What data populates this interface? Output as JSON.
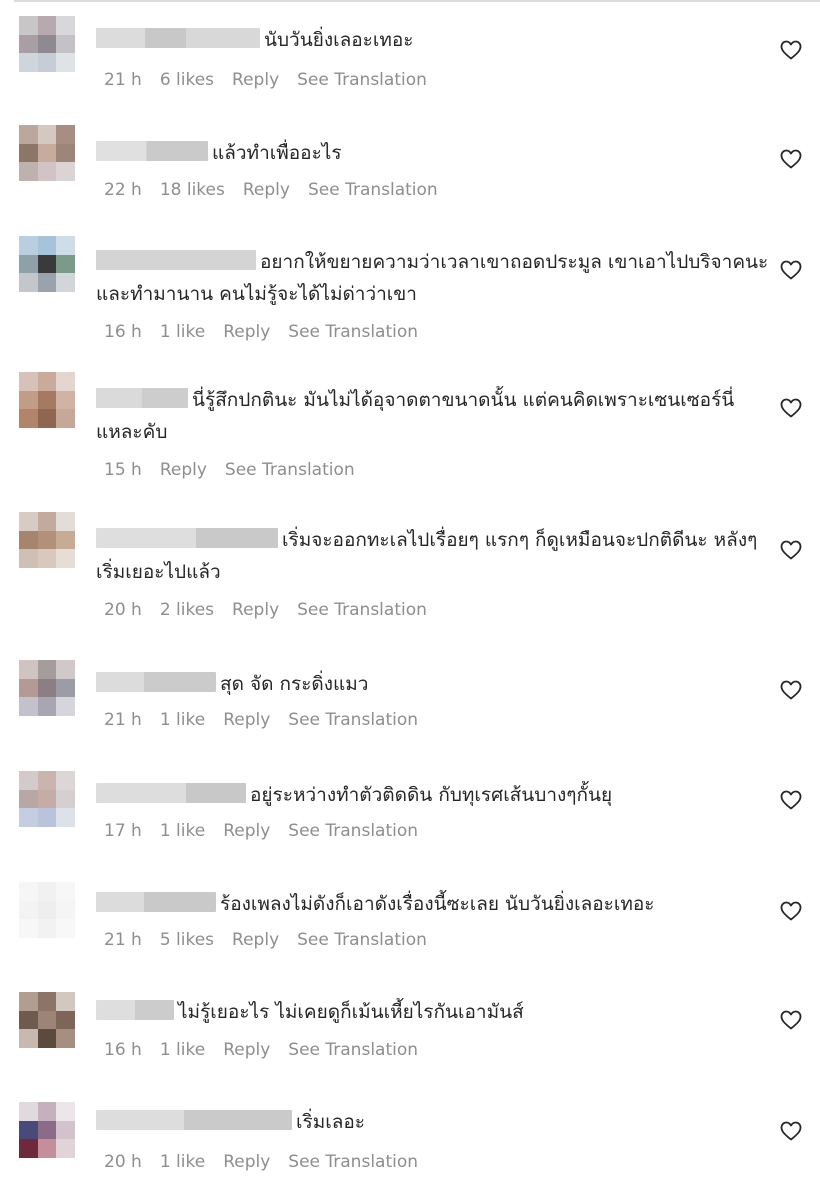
{
  "comments": [
    {
      "text": "นับวันยิ่งเลอะเทอะ",
      "time": "21 h",
      "likes": "6 likes",
      "reply": "Reply",
      "translate": "See Translation"
    },
    {
      "text": "แล้วทำเพื่ออะไร",
      "time": "22 h",
      "likes": "18 likes",
      "reply": "Reply",
      "translate": "See Translation"
    },
    {
      "text": "อยากให้ขยายความว่าเวลาเขาถอดประมูล เขาเอาไปบริจาคนะ และทำมานาน คนไม่รู้จะได้ไม่ด่าว่าเขา",
      "time": "16 h",
      "likes": "1 like",
      "reply": "Reply",
      "translate": "See Translation"
    },
    {
      "text": "นี่รู้สึกปกตินะ มันไม่ได้อุจาดตาขนาดนั้น แต่คนคิดเพราะเซนเซอร์นี่แหละคับ",
      "time": "15 h",
      "likes": "",
      "reply": "Reply",
      "translate": "See Translation"
    },
    {
      "text": "เริ่มจะออกทะเลไปเรื่อยๆ แรกๆ ก็ดูเหมือนจะปกติดีนะ หลังๆ เริ่มเยอะไปแล้ว",
      "time": "20 h",
      "likes": "2 likes",
      "reply": "Reply",
      "translate": "See Translation"
    },
    {
      "text": "สุด จัด กระดิ่งแมว",
      "time": "21 h",
      "likes": "1 like",
      "reply": "Reply",
      "translate": "See Translation"
    },
    {
      "text": "อยู่ระหว่างทำตัวติดดิน กับทุเรศเส้นบางๆกั้นยุ",
      "time": "17 h",
      "likes": "1 like",
      "reply": "Reply",
      "translate": "See Translation"
    },
    {
      "text": "ร้องเพลงไม่ดังก็เอาดังเรื่องนี้ซะเลย นับวันยิ่งเลอะเทอะ",
      "time": "21 h",
      "likes": "5 likes",
      "reply": "Reply",
      "translate": "See Translation"
    },
    {
      "text": "ไม่รู้เยอะไร ไม่เคยดูก็เม้นเหี้ยไรกันเอามันส์",
      "time": "16 h",
      "likes": "1 like",
      "reply": "Reply",
      "translate": "See Translation"
    },
    {
      "text": "เริ่มเลอะ",
      "time": "20 h",
      "likes": "1 like",
      "reply": "Reply",
      "translate": "See Translation"
    }
  ],
  "icons": {
    "like": "heart-outline-icon",
    "avatar": "pixelated-profile-photo"
  },
  "colors": {
    "text": "#262626",
    "meta": "#8e8e8e",
    "divider": "#dbdbdb"
  }
}
